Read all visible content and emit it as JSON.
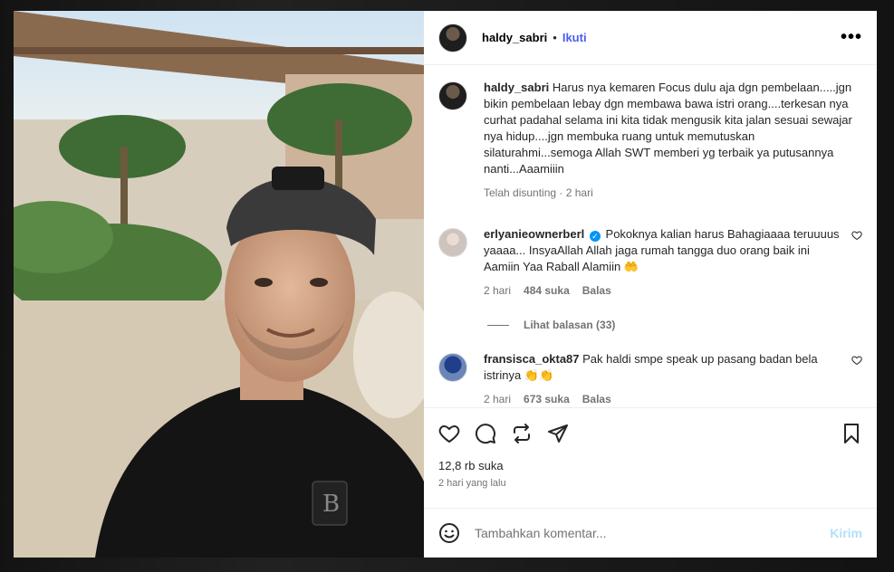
{
  "post": {
    "username": "haldy_sabri",
    "separator": "•",
    "follow_label": "Ikuti",
    "more_label": "•••"
  },
  "caption": {
    "username": "haldy_sabri",
    "text": "Harus nya kemaren Focus dulu aja dgn pembelaan.....jgn bikin pembelaan lebay dgn membawa bawa istri orang....terkesan nya curhat padahal selama ini kita tidak mengusik kita jalan sesuai sewajar nya hidup....jgn membuka ruang untuk memutuskan silaturahmi...semoga Allah SWT memberi yg terbaik ya putusannya nanti...Aaamiiin",
    "meta": "Telah disunting · 2 hari"
  },
  "comments": [
    {
      "username": "erlyanieownerberl",
      "verified_glyph": "✓",
      "text": "Pokoknya kalian harus Bahagiaaaa teruuuus yaaaa... InsyaAllah Allah jaga rumah tangga duo orang baik ini Aamiin Yaa Raball Alamiin 🤲",
      "time": "2 hari",
      "likes": "484 suka",
      "reply": "Balas",
      "view_replies": "Lihat balasan (33)"
    },
    {
      "username": "fransisca_okta87",
      "text": "Pak haldi smpe speak up pasang badan bela istrinya 👏👏",
      "time": "2 hari",
      "likes": "673 suka",
      "reply": "Balas"
    }
  ],
  "stats": {
    "likes": "12,8 rb suka",
    "posted": "2 hari yang lalu"
  },
  "composer": {
    "placeholder": "Tambahkan komentar...",
    "post_label": "Kirim"
  },
  "colors": {
    "accent": "#4a5df0",
    "verified": "#0095f6",
    "muted": "#737373"
  },
  "icons": [
    "heart-icon",
    "comment-icon",
    "repost-icon",
    "share-icon",
    "bookmark-icon",
    "emoji-icon",
    "more-icon"
  ]
}
